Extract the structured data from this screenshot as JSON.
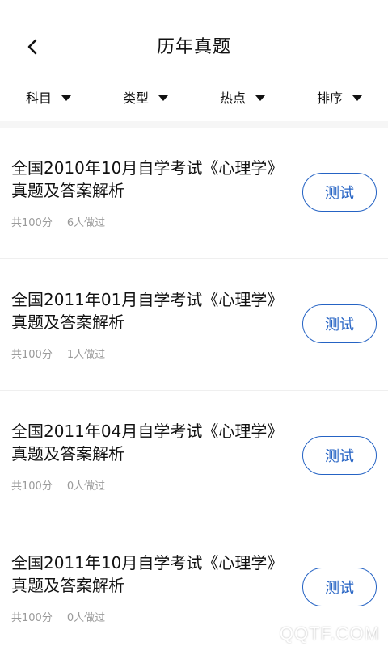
{
  "header": {
    "title": "历年真题"
  },
  "filters": [
    {
      "label": "科目"
    },
    {
      "label": "类型"
    },
    {
      "label": "热点"
    },
    {
      "label": "排序"
    }
  ],
  "items": [
    {
      "title": "全国2010年10月自学考试《心理学》真题及答案解析",
      "score": "共100分",
      "done": "6人做过",
      "button": "测试"
    },
    {
      "title": "全国2011年01月自学考试《心理学》真题及答案解析",
      "score": "共100分",
      "done": "1人做过",
      "button": "测试"
    },
    {
      "title": "全国2011年04月自学考试《心理学》真题及答案解析",
      "score": "共100分",
      "done": "0人做过",
      "button": "测试"
    },
    {
      "title": "全国2011年10月自学考试《心理学》真题及答案解析",
      "score": "共100分",
      "done": "0人做过",
      "button": "测试"
    }
  ],
  "watermark": "QQTF.COM",
  "colors": {
    "accent": "#2563c4",
    "meta": "#9a9a9a"
  }
}
